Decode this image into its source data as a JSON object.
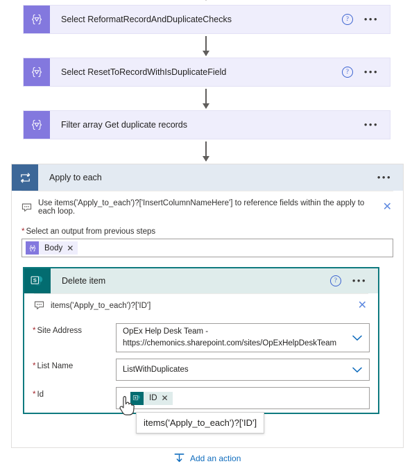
{
  "flow": {
    "nodes": [
      {
        "icon": "data-operation-icon",
        "title": "Select ReformatRecordAndDuplicateChecks",
        "has_help": true,
        "has_menu": true,
        "help_label": "?",
        "menu_label": "•••"
      },
      {
        "icon": "data-operation-icon",
        "title": "Select ResetToRecordWithIsDuplicateField",
        "has_help": true,
        "has_menu": true,
        "help_label": "?",
        "menu_label": "•••"
      },
      {
        "icon": "data-operation-icon",
        "title": "Filter array Get duplicate records",
        "has_help": false,
        "has_menu": true,
        "help_label": "?",
        "menu_label": "•••"
      }
    ]
  },
  "loop": {
    "icon": "apply-to-each-loop-icon",
    "title": "Apply to each",
    "menu_label": "•••",
    "tip": {
      "icon": "comment-bubble-icon",
      "text": "Use items('Apply_to_each')?['InsertColumnNameHere'] to reference fields within the apply to each loop.",
      "dismiss_label": "✕"
    },
    "output_field": {
      "required_marker": "*",
      "label": "Select an output from previous steps",
      "chip": {
        "icon": "data-operation-icon",
        "label": "Body",
        "remove_label": "✕"
      }
    }
  },
  "sharepoint_card": {
    "icon": "sharepoint-icon",
    "title": "Delete item",
    "help_label": "?",
    "menu_label": "•••",
    "tip": {
      "icon": "comment-bubble-icon",
      "text": "items('Apply_to_each')?['ID']",
      "dismiss_label": "✕"
    },
    "fields": [
      {
        "required_marker": "*",
        "label": "Site Address",
        "value": "OpEx Help Desk Team - https://chemonics.sharepoint.com/sites/OpExHelpDeskTeam",
        "value_line1": "OpEx Help Desk Team -",
        "value_line2": "https://chemonics.sharepoint.com/sites/OpExHelpDeskTeam",
        "control": "dropdown"
      },
      {
        "required_marker": "*",
        "label": "List Name",
        "value": "ListWithDuplicates",
        "control": "dropdown"
      },
      {
        "required_marker": "*",
        "label": "Id",
        "control": "token",
        "chip": {
          "icon": "sharepoint-icon",
          "label": "ID",
          "remove_label": "✕"
        }
      }
    ]
  },
  "tooltip": {
    "text": "items('Apply_to_each')?['ID']"
  },
  "add_action": {
    "icon": "insert-below-icon",
    "label": "Add an action"
  },
  "colors": {
    "data_operation_purple": "#8378de",
    "data_operation_bg": "#efeefc",
    "loop_blue": "#3c6798",
    "loop_bg": "#e3eaf2",
    "sharepoint_teal": "#036c70",
    "sharepoint_bg": "#dfeceb",
    "sharepoint_border": "#0f7a7f",
    "link_blue": "#0f6cbd",
    "required_red": "#a4262c",
    "connector_gray": "#605e5c"
  }
}
